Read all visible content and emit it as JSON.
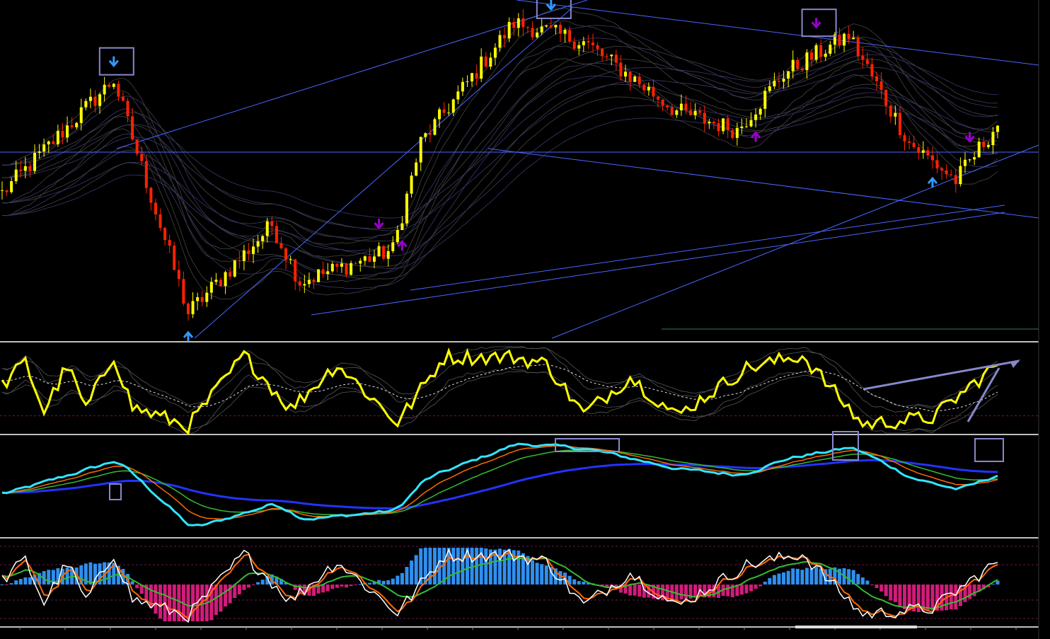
{
  "colors": {
    "background": "#000000",
    "separator": "#ffffff",
    "bull_body": "#ffff00",
    "bear_body": "#ff2200",
    "oscillator_line": "#ffff00",
    "fast_line": "#33e5ff",
    "ma_orange": "#ff6a00",
    "ma_green": "#33bb33",
    "ma_blue": "#2233ff",
    "histogram_pos": "#2f8ff0",
    "histogram_neg": "#d21b7a",
    "stoch_main": "#ffffff",
    "stoch_signal": "#ff6a00",
    "arrow_down": "#3399ff",
    "arrow_up": "#3399ff",
    "arrow_purple": "#9900cc",
    "trendline": "#4a66ff",
    "box": "#8888cc"
  },
  "chart_data": [
    {
      "type": "candlestick",
      "pane": "price",
      "title": "",
      "xlabel": "",
      "ylabel": "",
      "grid": false,
      "legend": "none",
      "swing_points": [
        {
          "bar": 0,
          "value": 46
        },
        {
          "bar": 24,
          "value": 82
        },
        {
          "bar": 40,
          "value": 8
        },
        {
          "bar": 58,
          "value": 36
        },
        {
          "bar": 64,
          "value": 18
        },
        {
          "bar": 84,
          "value": 28
        },
        {
          "bar": 90,
          "value": 62
        },
        {
          "bar": 110,
          "value": 100
        },
        {
          "bar": 125,
          "value": 94
        },
        {
          "bar": 145,
          "value": 72
        },
        {
          "bar": 158,
          "value": 66
        },
        {
          "bar": 168,
          "value": 84
        },
        {
          "bar": 182,
          "value": 96
        },
        {
          "bar": 195,
          "value": 62
        },
        {
          "bar": 205,
          "value": 50
        },
        {
          "bar": 214,
          "value": 68
        }
      ],
      "bar_count": 215,
      "signal_arrows": [
        {
          "type": "down",
          "bar": 24,
          "color": "blue"
        },
        {
          "type": "up",
          "bar": 40,
          "color": "blue"
        },
        {
          "type": "down",
          "bar": 81,
          "color": "purple"
        },
        {
          "type": "up",
          "bar": 86,
          "color": "purple"
        },
        {
          "type": "down",
          "bar": 118,
          "color": "blue"
        },
        {
          "type": "up",
          "bar": 162,
          "color": "purple"
        },
        {
          "type": "down",
          "bar": 175,
          "color": "purple"
        },
        {
          "type": "up",
          "bar": 200,
          "color": "blue"
        },
        {
          "type": "down",
          "bar": 208,
          "color": "purple"
        }
      ]
    },
    {
      "type": "line",
      "pane": "oscillator",
      "title": "",
      "legend": "none",
      "grid": false,
      "series": [
        {
          "style": "thick-yellow"
        },
        {
          "style": "dashed-white"
        }
      ],
      "swing_points": [
        {
          "bar": 0,
          "value": 55
        },
        {
          "bar": 5,
          "value": 82
        },
        {
          "bar": 9,
          "value": 25
        },
        {
          "bar": 14,
          "value": 78
        },
        {
          "bar": 18,
          "value": 28
        },
        {
          "bar": 24,
          "value": 90
        },
        {
          "bar": 28,
          "value": 30
        },
        {
          "bar": 40,
          "value": 8
        },
        {
          "bar": 52,
          "value": 90
        },
        {
          "bar": 62,
          "value": 28
        },
        {
          "bar": 72,
          "value": 80
        },
        {
          "bar": 85,
          "value": 12
        },
        {
          "bar": 95,
          "value": 88
        },
        {
          "bar": 110,
          "value": 88
        },
        {
          "bar": 117,
          "value": 80
        },
        {
          "bar": 125,
          "value": 22
        },
        {
          "bar": 135,
          "value": 65
        },
        {
          "bar": 145,
          "value": 20
        },
        {
          "bar": 160,
          "value": 75
        },
        {
          "bar": 172,
          "value": 90
        },
        {
          "bar": 185,
          "value": 10
        },
        {
          "bar": 200,
          "value": 18
        },
        {
          "bar": 214,
          "value": 80
        }
      ]
    },
    {
      "type": "line",
      "pane": "moving-averages",
      "title": "",
      "legend": "none",
      "grid": false,
      "series": [
        {
          "style": "thick-cyan"
        },
        {
          "style": "orange"
        },
        {
          "style": "green"
        },
        {
          "style": "thick-blue"
        }
      ]
    },
    {
      "type": "bar",
      "pane": "histogram-stochastic",
      "title": "",
      "legend": "none",
      "grid": false,
      "series": [
        {
          "style": "histogram"
        },
        {
          "style": "white-line"
        },
        {
          "style": "orange-line"
        },
        {
          "style": "green-line"
        }
      ]
    }
  ]
}
